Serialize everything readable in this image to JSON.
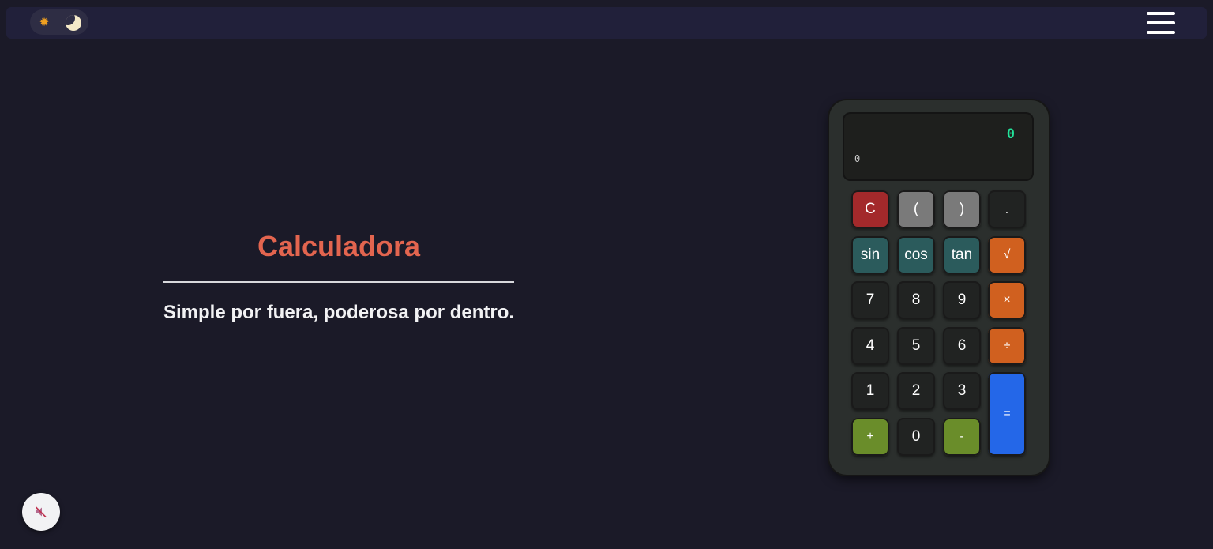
{
  "theme_toggle": {
    "light_icon": "sun-icon",
    "dark_icon": "moon-icon"
  },
  "menu": {
    "icon": "hamburger-menu-icon"
  },
  "hero": {
    "title": "Calculadora",
    "subtitle": "Simple por fuera, poderosa por dentro."
  },
  "calculator": {
    "display": {
      "result": "0",
      "expression": "0"
    },
    "keys": {
      "clear": "C",
      "paren_open": "(",
      "paren_close": ")",
      "decimal": ".",
      "sin": "sin",
      "cos": "cos",
      "tan": "tan",
      "sqrt": "√",
      "seven": "7",
      "eight": "8",
      "nine": "9",
      "multiply": "×",
      "four": "4",
      "five": "5",
      "six": "6",
      "divide": "÷",
      "one": "1",
      "two": "2",
      "three": "3",
      "equals": "=",
      "plus": "+",
      "zero": "0",
      "minus": "-"
    }
  },
  "sound": {
    "icon": "muted-speaker-icon",
    "state": "muted"
  },
  "colors": {
    "background": "#1b1a28",
    "title": "#e3654f",
    "result_text": "#22e39a",
    "clear_key": "#a3292b",
    "paren_key": "#7a7a7a",
    "trig_key": "#2b5b5c",
    "operator_key": "#d0601f",
    "add_sub_key": "#6a8d2a",
    "equals_key": "#2467e8"
  }
}
